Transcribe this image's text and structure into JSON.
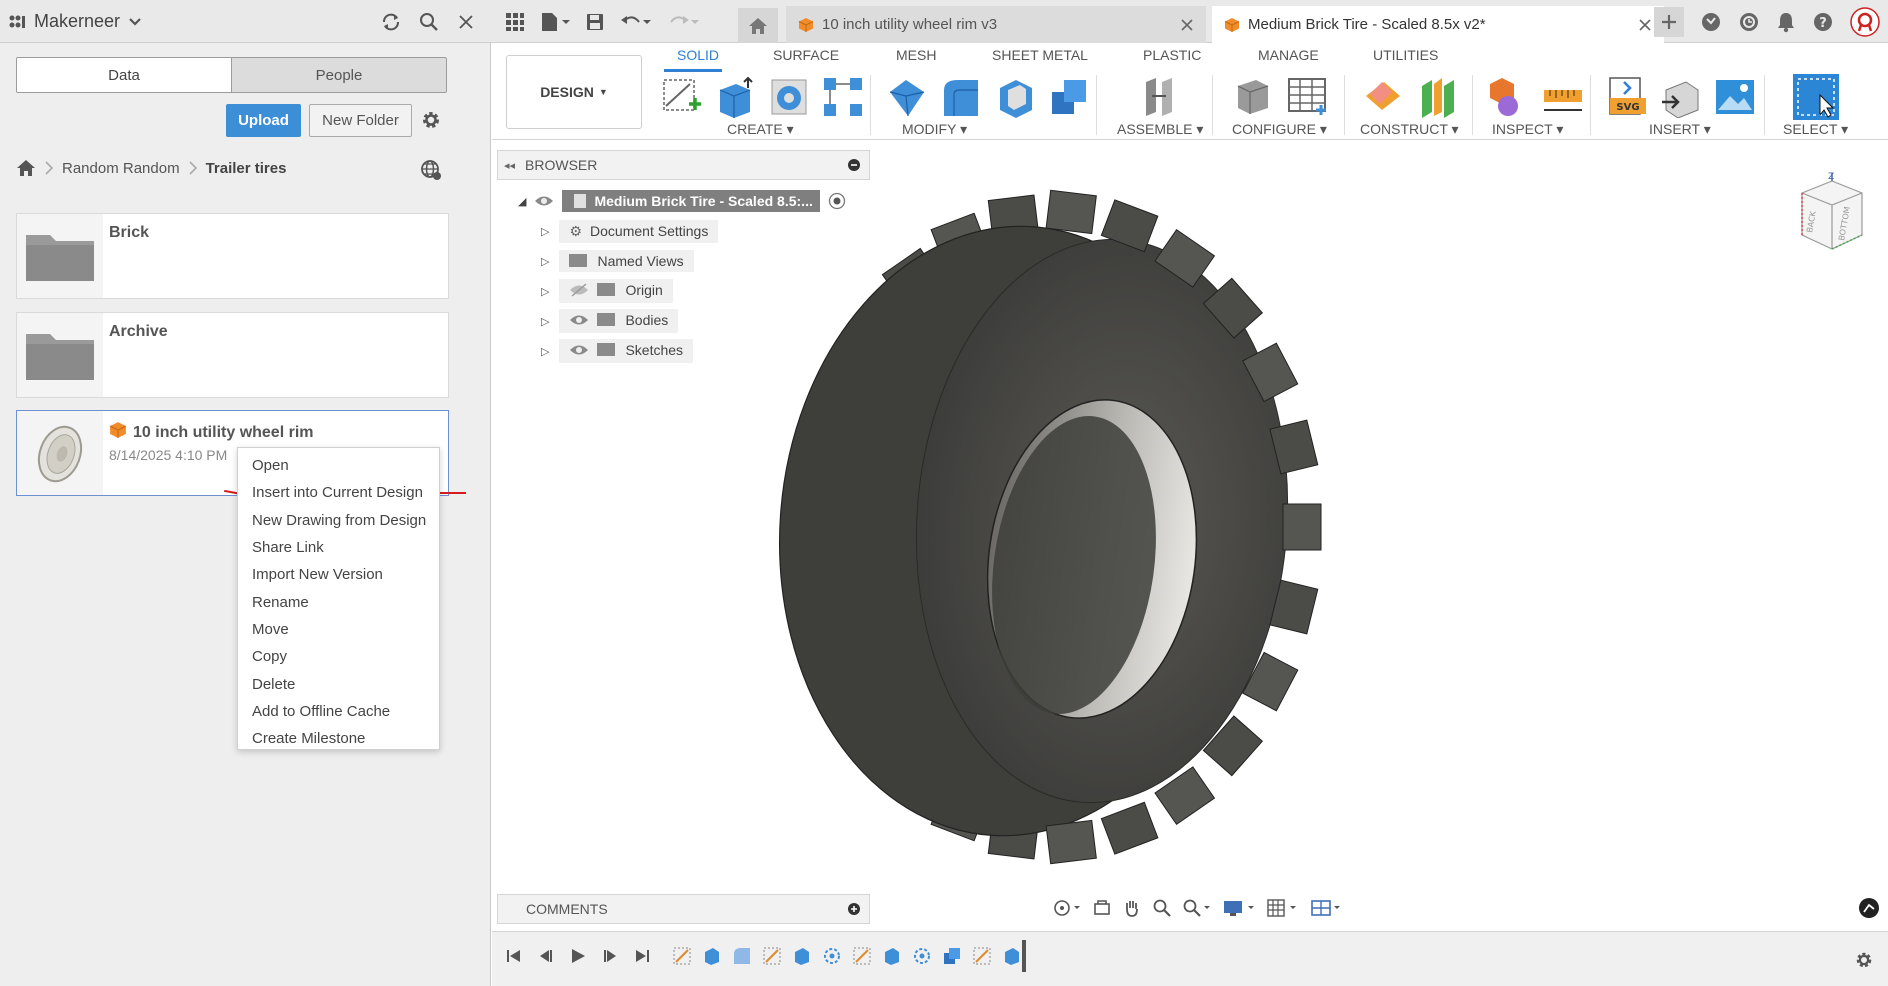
{
  "topbar": {
    "team_name": "Makerneer",
    "tabs": [
      {
        "label": "10 inch utility wheel rim v3",
        "active": false
      },
      {
        "label": "Medium Brick Tire - Scaled 8.5x v2*",
        "active": true
      }
    ]
  },
  "data_panel": {
    "tab_data": "Data",
    "tab_people": "People",
    "upload_label": "Upload",
    "new_folder_label": "New Folder",
    "breadcrumb": [
      "Random Random",
      "Trailer tires"
    ],
    "items": [
      {
        "name": "Brick",
        "kind": "folder"
      },
      {
        "name": "Archive",
        "kind": "folder"
      },
      {
        "name": "10 inch utility wheel rim",
        "kind": "design",
        "date": "8/14/2025 4:10 PM"
      }
    ]
  },
  "context_menu": {
    "items": [
      "Open",
      "Insert into Current Design",
      "New Drawing from Design",
      "Share Link",
      "Import New Version",
      "Rename",
      "Move",
      "Copy",
      "Delete",
      "Add to Offline Cache",
      "Create Milestone"
    ]
  },
  "toolbar": {
    "workspace": "DESIGN",
    "tabs": [
      "SOLID",
      "SURFACE",
      "MESH",
      "SHEET METAL",
      "PLASTIC",
      "MANAGE",
      "UTILITIES"
    ],
    "active_tab": "SOLID",
    "groups": [
      "CREATE",
      "MODIFY",
      "ASSEMBLE",
      "CONFIGURE",
      "CONSTRUCT",
      "INSPECT",
      "INSERT",
      "SELECT"
    ]
  },
  "browser": {
    "title": "BROWSER",
    "root": "Medium Brick Tire - Scaled 8.5:...",
    "nodes": [
      "Document Settings",
      "Named Views",
      "Origin",
      "Bodies",
      "Sketches"
    ]
  },
  "comments": {
    "title": "COMMENTS"
  },
  "viewcube": {
    "faces": [
      "BACK",
      "BOTTOM",
      "Z"
    ]
  },
  "colors": {
    "accent": "#2f7fd3",
    "upload": "#3c8ed6",
    "annotation": "#d21e1e",
    "tire": "#4a4a47"
  }
}
